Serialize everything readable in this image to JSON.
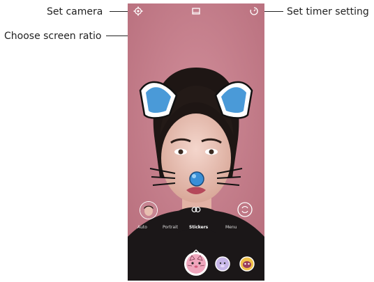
{
  "callouts": {
    "set_camera": "Set camera",
    "choose_ratio": "Choose screen ratio",
    "set_timer": "Set timer setting"
  },
  "camera": {
    "icons": {
      "settings": "gear-icon",
      "ratio": "screen-ratio-icon",
      "timer": "timer-icon",
      "flip": "switch-camera-icon",
      "expand": "chevron-up-icon"
    },
    "modes": [
      "Auto",
      "Portrait",
      "Stickers",
      "Menu"
    ],
    "active_mode": "Stickers"
  },
  "colors": {
    "background": "#c8808c",
    "ear_blue": "#4a9ad8",
    "nose_blue": "#3a8fd6",
    "icon": "#ffffff"
  }
}
